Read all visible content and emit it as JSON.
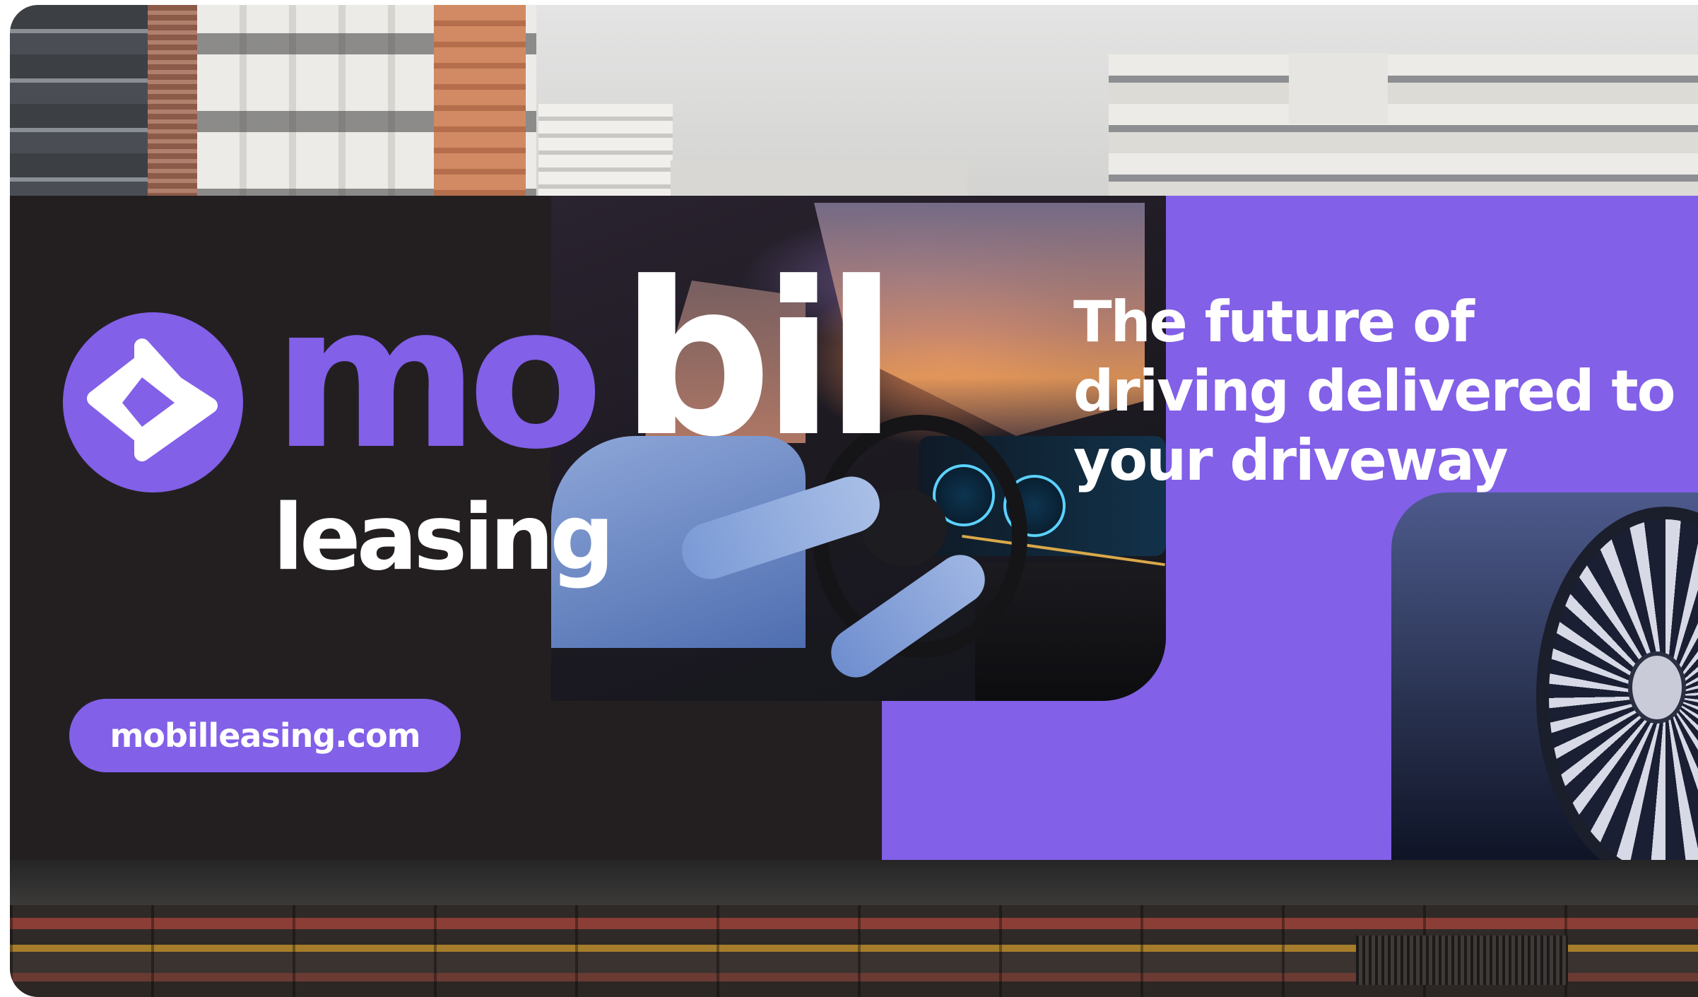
{
  "billboard": {
    "brand_part1": "mo",
    "brand_part2": "bil",
    "brand_sub": "leasing",
    "headline": "The future of driving delivered to your driveway",
    "website": "mobilleasing.com",
    "logo_icon": "mobil-logo-icon"
  },
  "colors": {
    "brand_purple": "#8260e8",
    "billboard_dark": "#231f21",
    "text_white": "#ffffff"
  }
}
